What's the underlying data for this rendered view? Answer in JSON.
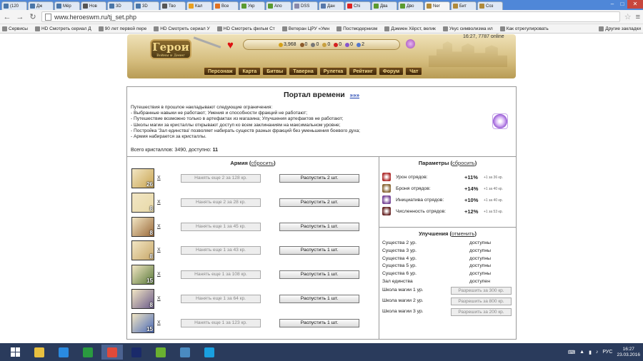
{
  "browser": {
    "tabs": [
      {
        "label": "(120",
        "color": "#4a76a8"
      },
      {
        "label": "Дж",
        "color": "#4a76a8"
      },
      {
        "label": "Мёр",
        "color": "#4a76a8"
      },
      {
        "label": "Нов",
        "color": "#555555"
      },
      {
        "label": "3D",
        "color": "#4a76a8"
      },
      {
        "label": "3D",
        "color": "#4a76a8"
      },
      {
        "label": "Тво",
        "color": "#555555"
      },
      {
        "label": "Кал",
        "color": "#e8a020"
      },
      {
        "label": "Все",
        "color": "#e07020"
      },
      {
        "label": "Укр",
        "color": "#5a9a30"
      },
      {
        "label": "Апо",
        "color": "#5a9a30"
      },
      {
        "label": "DSS",
        "color": "#8888aa"
      },
      {
        "label": "Дан",
        "color": "#5577aa"
      },
      {
        "label": "Chi",
        "color": "#d22"
      },
      {
        "label": "Два",
        "color": "#5a9a30"
      },
      {
        "label": "Дво",
        "color": "#5a9a30"
      },
      {
        "label": "Ner",
        "color": "#b08a3a",
        "active": true
      },
      {
        "label": "Бит",
        "color": "#b08a3a"
      },
      {
        "label": "Соз",
        "color": "#b08a3a"
      }
    ],
    "url": "www.heroeswm.ru/tj_set.php",
    "bookmarks": [
      "Сервисы",
      "HD Смотреть сериал Д",
      "90 лет первой пере",
      "HD Смотреть сериал У",
      "HD Смотреть фильм Ст",
      "Ветеран ЦРУ «Умн",
      "Постмодернизм",
      "Дэмиен Хёрст, велик",
      "Укус символизма ил",
      "Как отрегулировать",
      "Другие закладки"
    ]
  },
  "game": {
    "logo_title": "Герои",
    "logo_subtitle": "Войны и Денег",
    "online_text": "16:27, 7787 online",
    "resources": [
      {
        "value": "3,968",
        "color": "#d4a017"
      },
      {
        "value": "0",
        "color": "#8b5a2b"
      },
      {
        "value": "0",
        "color": "#777777"
      },
      {
        "value": "0",
        "color": "#c8a040"
      },
      {
        "value": "0",
        "color": "#d42020"
      },
      {
        "value": "0",
        "color": "#8855cc"
      },
      {
        "value": "2",
        "color": "#5577cc"
      }
    ],
    "nav": [
      "Персонаж",
      "Карта",
      "Битвы",
      "Таверна",
      "Рулетка",
      "Рейтинг",
      "Форум",
      "Чат"
    ]
  },
  "portal": {
    "title": "Портал времени",
    "more_link": "»»»",
    "intro": "Путешествия в прошлое накладывают следующие ограничения:",
    "restrictions": [
      "- Выбранные навыки не работают; Умения и способности фракций не работают;",
      "- Путешествие возможно только в артефактах из магазина; Улучшения артефактов не работают;",
      "- Школы магии за кристаллы открывают доступ ко всем заклинаниям на максимальном уровне;",
      "- Постройка 'Зал единства' позволяет набирать существ разных фракций без уменьшения боевого духа;",
      "- Армия набирается за кристаллы."
    ],
    "crystals_label": "Всего кристаллов: 3490, доступно:",
    "crystals_available": "11"
  },
  "army": {
    "title": "Армия",
    "reset_link": "сбросить",
    "units": [
      {
        "count": "26",
        "x": "X",
        "hire": "Нанять еще 2 за 128 кр.",
        "dismiss": "Распустить 2 шт.",
        "color": "#c9a450"
      },
      {
        "count": "8",
        "x": "X",
        "hire": "Нанять еще 2 за 28 кр.",
        "dismiss": "Распустить 2 шт.",
        "color": "#e8d9a8"
      },
      {
        "count": "8",
        "x": "X",
        "hire": "Нанять еще 1 за 45 кр.",
        "dismiss": "Распустить 1 шт.",
        "color": "#9b6a3a"
      },
      {
        "count": "8",
        "x": "X",
        "hire": "Нанять еще 1 за 43 кр.",
        "dismiss": "Распустить 1 шт.",
        "color": "#c8a86a"
      },
      {
        "count": "15",
        "x": "X",
        "hire": "Нанять еще 1 за 108 кр.",
        "dismiss": "Распустить 1 шт.",
        "color": "#5a7a3a"
      },
      {
        "count": "8",
        "x": "X",
        "hire": "Нанять еще 1 за 64 кр.",
        "dismiss": "Распустить 1 шт.",
        "color": "#6a5a8a"
      },
      {
        "count": "15",
        "x": "X",
        "hire": "Нанять еще 1 за 123 кр.",
        "dismiss": "Распустить 1 шт.",
        "color": "#4a6ab8"
      }
    ]
  },
  "params": {
    "title": "Параметры",
    "reset_link": "сбросить",
    "rows": [
      {
        "label": "Урон отрядов:",
        "value": "+11%",
        "cost": "+1 за 36 кр.",
        "color": "#b03030"
      },
      {
        "label": "Броня отрядов:",
        "value": "+14%",
        "cost": "+1 за 40 кр.",
        "color": "#8a6a3a"
      },
      {
        "label": "Инициатива отрядов:",
        "value": "+10%",
        "cost": "+1 за 40 кр.",
        "color": "#7a4a9a"
      },
      {
        "label": "Численность отрядов:",
        "value": "+12%",
        "cost": "+1 за 53 кр.",
        "color": "#6a2a2a"
      }
    ]
  },
  "upgrades": {
    "title": "Улучшения",
    "cancel_link": "отменить",
    "rows": [
      {
        "name": "Существа 2 ур.",
        "status": "доступны"
      },
      {
        "name": "Существа 3 ур.",
        "status": "доступны"
      },
      {
        "name": "Существа 4 ур.",
        "status": "доступны"
      },
      {
        "name": "Существа 5 ур.",
        "status": "доступны"
      },
      {
        "name": "Существа 6 ур.",
        "status": "доступны"
      },
      {
        "name": "Зал единства",
        "status": "доступен"
      }
    ],
    "schools": [
      {
        "name": "Школа магии 1 ур.",
        "button": "Разрешить за 300 кр."
      },
      {
        "name": "Школа магии 2 ур.",
        "button": "Разрешить за 800 кр."
      },
      {
        "name": "Школа магии 3 ур.",
        "button": "Разрешить за 200 кр."
      }
    ]
  },
  "taskbar": {
    "apps": [
      {
        "name": "file-explorer-icon",
        "color": "#e8c040"
      },
      {
        "name": "internet-explorer-icon",
        "color": "#2a8ae0"
      },
      {
        "name": "store-icon",
        "color": "#2a9a40"
      },
      {
        "name": "chrome-icon",
        "color": "#e04a3a",
        "active": true
      },
      {
        "name": "photoshop-icon",
        "color": "#1a2a6a"
      },
      {
        "name": "utorrent-icon",
        "color": "#6ab030"
      },
      {
        "name": "photos-icon",
        "color": "#4a8ac0"
      },
      {
        "name": "skype-icon",
        "color": "#1aa0e0"
      }
    ],
    "lang": "РУС",
    "time": "16:27",
    "date": "23.03.2016"
  }
}
